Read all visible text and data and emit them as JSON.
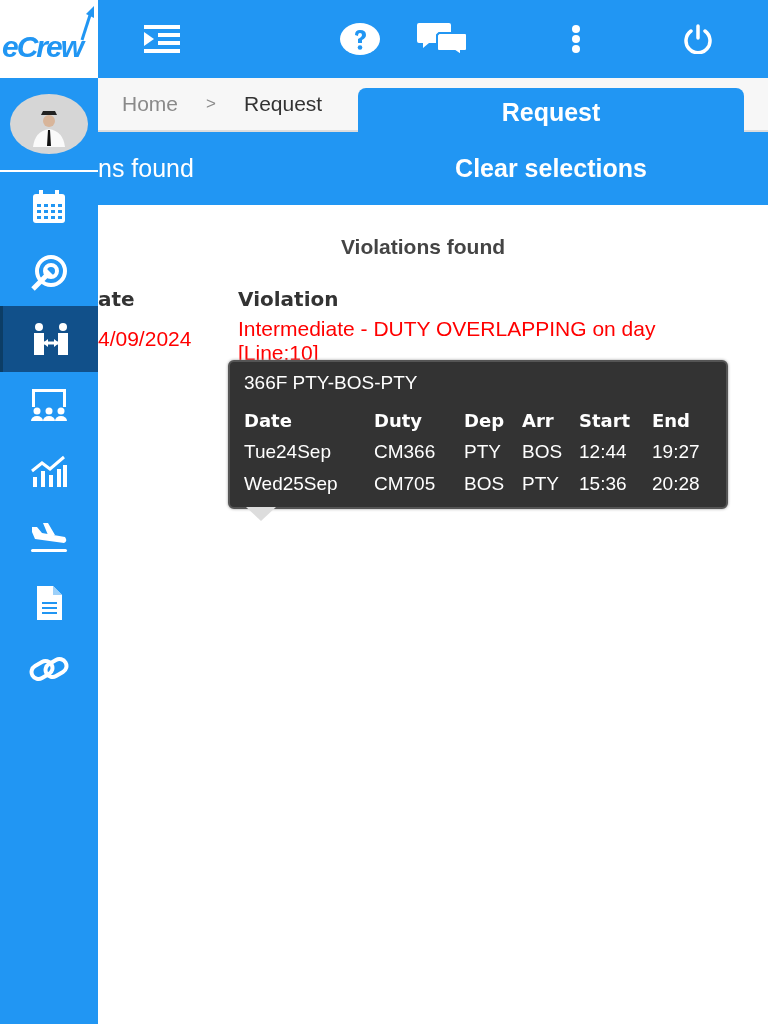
{
  "logo": {
    "text": "eCrew"
  },
  "sidebar": {
    "items": [
      {
        "kind": "calendar",
        "selected": false
      },
      {
        "kind": "target",
        "selected": false
      },
      {
        "kind": "exchange",
        "selected": true
      },
      {
        "kind": "presentation",
        "selected": false
      },
      {
        "kind": "chart",
        "selected": false
      },
      {
        "kind": "landing",
        "selected": false
      },
      {
        "kind": "document",
        "selected": false
      },
      {
        "kind": "link",
        "selected": false
      }
    ]
  },
  "breadcrumb": [
    "Home",
    ">",
    "Request"
  ],
  "panel": {
    "heading": "ns found",
    "tab": "Request",
    "button": "Clear selections"
  },
  "violations": {
    "title": "Violations found",
    "columns": [
      "ate",
      "Violation"
    ],
    "rows": [
      {
        "date": "4/09/2024",
        "violation": "Intermediate - DUTY OVERLAPPING on day",
        "line": "[Line:10]"
      }
    ]
  },
  "tooltip": {
    "title": "366F PTY-BOS-PTY",
    "columns": [
      "Date",
      "Duty",
      "Dep",
      "Arr",
      "Start",
      "End"
    ],
    "rows": [
      [
        "Tue24Sep",
        "CM366",
        "PTY",
        "BOS",
        "12:44",
        "19:27"
      ],
      [
        "Wed25Sep",
        "CM705",
        "BOS",
        "PTY",
        "15:36",
        "20:28"
      ]
    ]
  }
}
